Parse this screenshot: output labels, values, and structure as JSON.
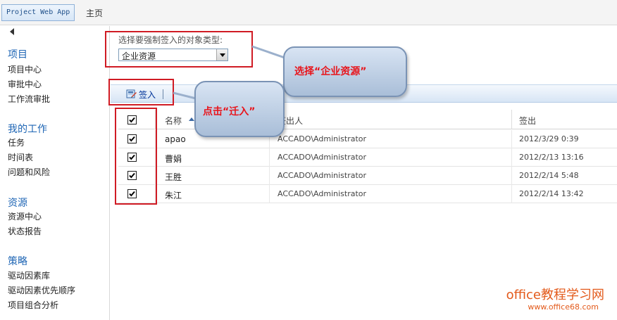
{
  "topbar": {
    "app_name": "Project Web App",
    "home": "主页"
  },
  "nav": {
    "sections": [
      {
        "heading": "项目",
        "items": [
          "项目中心",
          "审批中心",
          "工作流审批"
        ]
      },
      {
        "heading": "我的工作",
        "items": [
          "任务",
          "时间表",
          "问题和风险"
        ]
      },
      {
        "heading": "资源",
        "items": [
          "资源中心",
          "状态报告"
        ]
      },
      {
        "heading": "策略",
        "items": [
          "驱动因素库",
          "驱动因素优先顺序",
          "项目组合分析"
        ]
      }
    ]
  },
  "form": {
    "label": "选择要强制签入的对象类型:",
    "selected": "企业资源"
  },
  "toolbar": {
    "checkin_label": "签入"
  },
  "grid": {
    "columns": [
      "名称",
      "签出人",
      "签出"
    ],
    "rows": [
      {
        "name": "apao",
        "checked_out_by": "ACCADO\\Administrator",
        "checked_out": "2012/3/29 0:39"
      },
      {
        "name": "曹娟",
        "checked_out_by": "ACCADO\\Administrator",
        "checked_out": "2012/2/13 13:16"
      },
      {
        "name": "王胜",
        "checked_out_by": "ACCADO\\Administrator",
        "checked_out": "2012/2/14 5:48"
      },
      {
        "name": "朱江",
        "checked_out_by": "ACCADO\\Administrator",
        "checked_out": "2012/2/14 13:42"
      }
    ]
  },
  "annotations": {
    "select_callout": "选择“企业资源”",
    "checkin_callout": "点击“迁入”"
  },
  "watermark": {
    "line1": "office教程学习网",
    "line2": "www.office68.com"
  },
  "colors": {
    "accent": "#1f66b5",
    "annotation_red": "#d01b24"
  }
}
